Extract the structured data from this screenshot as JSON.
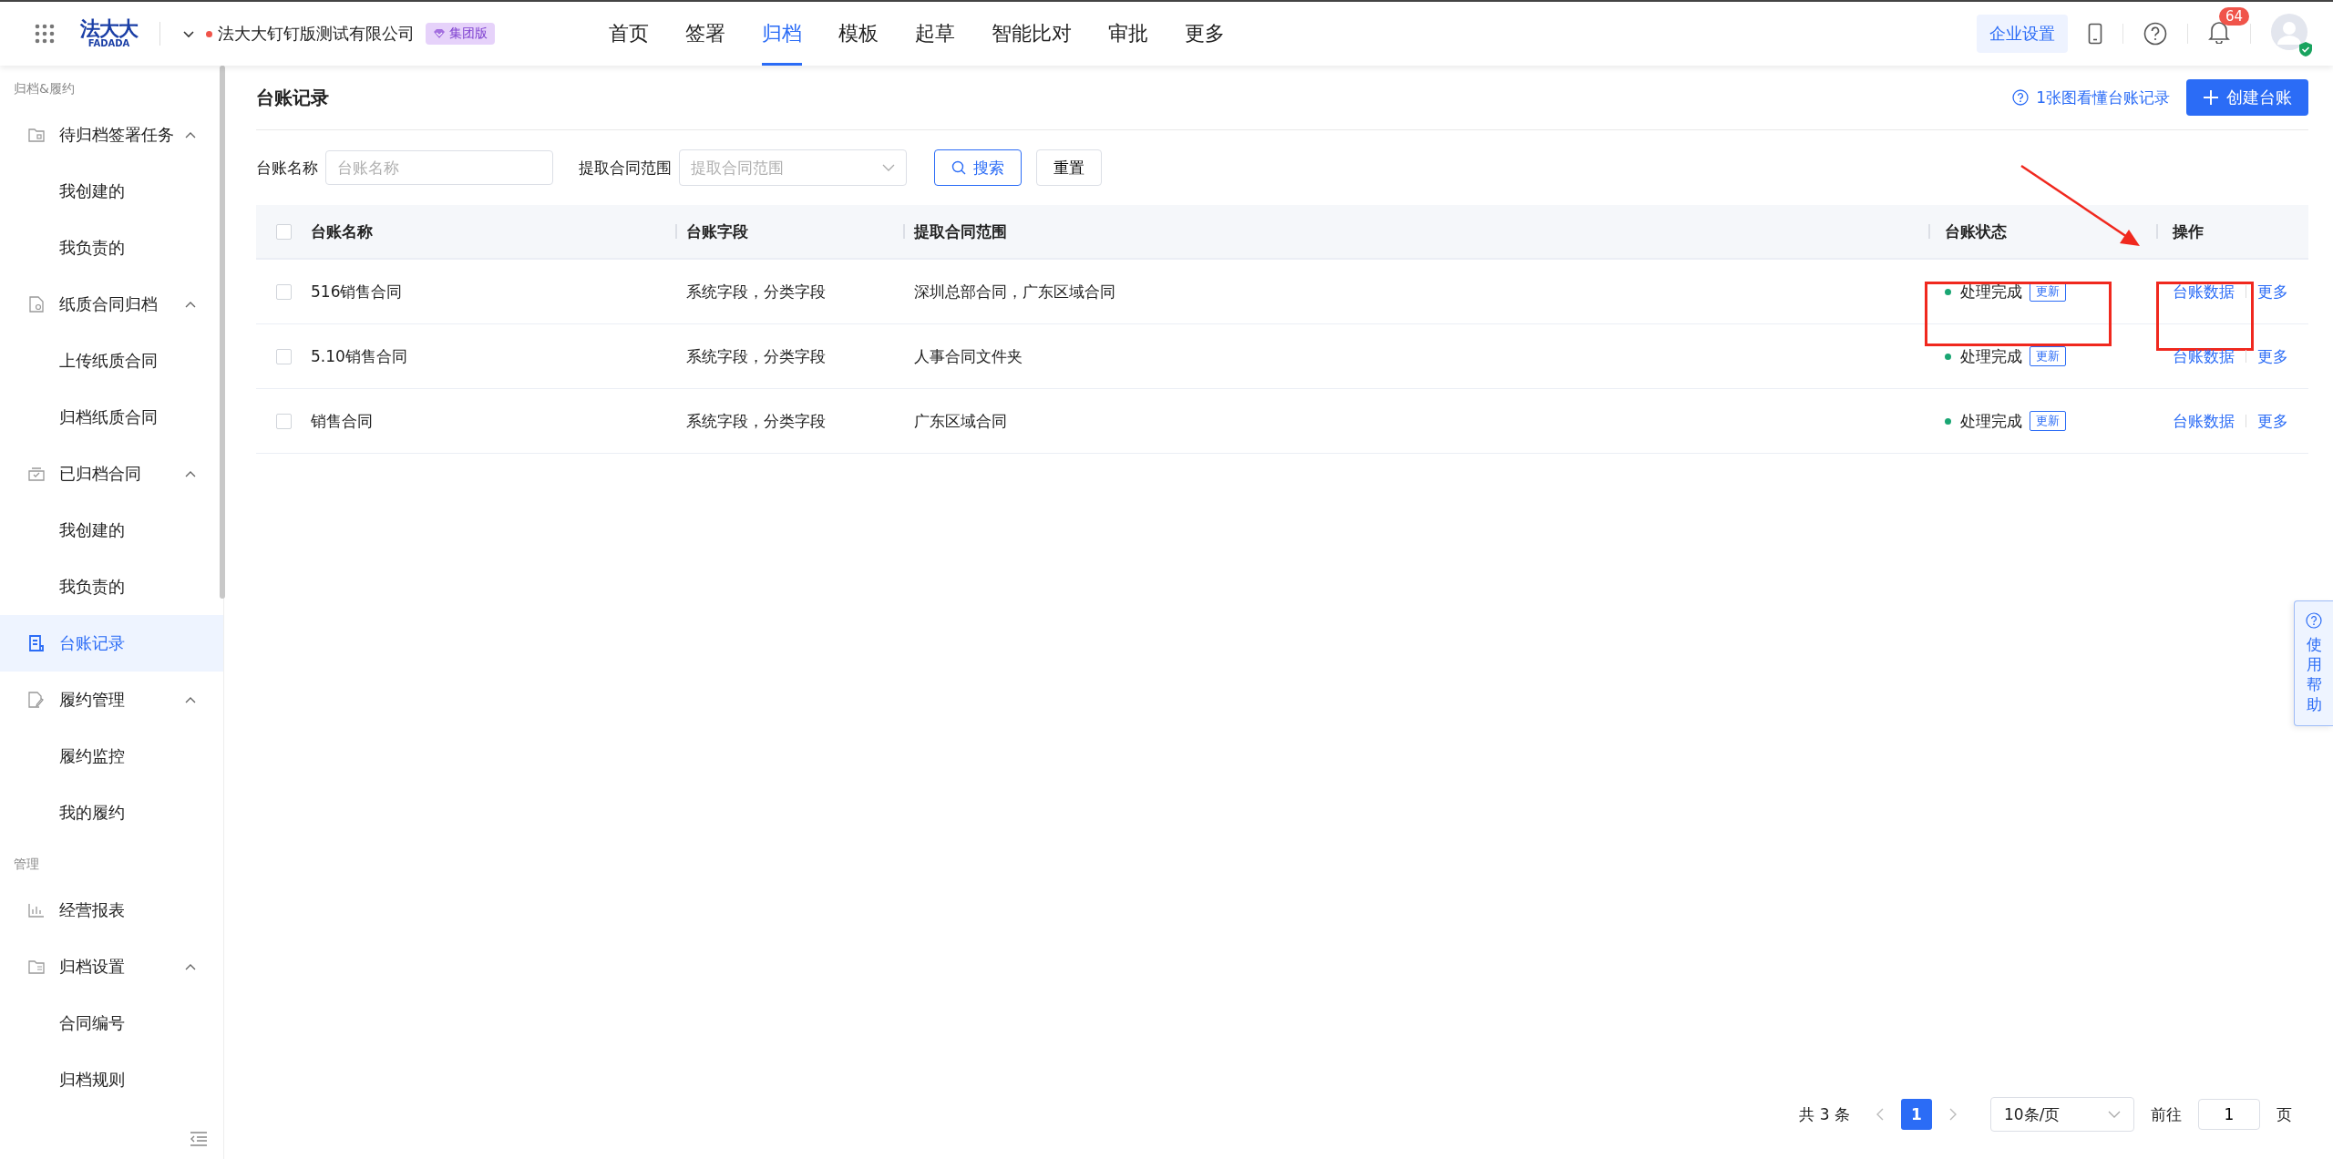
{
  "header": {
    "logo": {
      "mark": "法大大",
      "sub": "FADADA"
    },
    "org": {
      "name": "法大大钉钉版测试有限公司",
      "edition": "集团版"
    },
    "nav": [
      {
        "label": "首页",
        "selected": false
      },
      {
        "label": "签署",
        "selected": false
      },
      {
        "label": "归档",
        "selected": true
      },
      {
        "label": "模板",
        "selected": false
      },
      {
        "label": "起草",
        "selected": false
      },
      {
        "label": "智能比对",
        "selected": false
      },
      {
        "label": "审批",
        "selected": false
      },
      {
        "label": "更多",
        "selected": false
      }
    ],
    "settings_button": "企业设置",
    "notification_count": "64"
  },
  "sidebar": {
    "sections": [
      {
        "title": "归档&履约",
        "items": [
          {
            "kind": "group",
            "label": "待归档签署任务",
            "expanded": true,
            "children": [
              {
                "label": "我创建的",
                "selected": false
              },
              {
                "label": "我负责的",
                "selected": false
              }
            ]
          },
          {
            "kind": "group",
            "label": "纸质合同归档",
            "expanded": true,
            "children": [
              {
                "label": "上传纸质合同",
                "selected": false
              },
              {
                "label": "归档纸质合同",
                "selected": false
              }
            ]
          },
          {
            "kind": "group",
            "label": "已归档合同",
            "expanded": true,
            "children": [
              {
                "label": "我创建的",
                "selected": false
              },
              {
                "label": "我负责的",
                "selected": false
              }
            ]
          },
          {
            "kind": "link",
            "label": "台账记录",
            "selected": true
          },
          {
            "kind": "group",
            "label": "履约管理",
            "expanded": true,
            "children": [
              {
                "label": "履约监控",
                "selected": false
              },
              {
                "label": "我的履约",
                "selected": false
              }
            ]
          }
        ]
      },
      {
        "title": "管理",
        "items": [
          {
            "kind": "link",
            "label": "经营报表",
            "selected": false
          },
          {
            "kind": "group",
            "label": "归档设置",
            "expanded": true,
            "children": [
              {
                "label": "合同编号",
                "selected": false
              },
              {
                "label": "归档规则",
                "selected": false
              }
            ]
          }
        ]
      }
    ]
  },
  "page": {
    "title": "台账记录",
    "help_link": "1张图看懂台账记录",
    "create_button": "创建台账"
  },
  "filters": [
    {
      "kind": "input",
      "label": "台账名称",
      "placeholder": "台账名称"
    },
    {
      "kind": "select",
      "label": "提取合同范围",
      "placeholder": "提取合同范围"
    }
  ],
  "search_button": "搜索",
  "reset_button": "重置",
  "table": {
    "select_all_checked": false,
    "columns": [
      "台账名称",
      "台账字段",
      "提取合同范围",
      "台账状态",
      "操作"
    ],
    "rows": [
      {
        "checked": false,
        "name": "516销售合同",
        "fields": "系统字段，分类字段",
        "scope": "深圳总部合同，广东区域合同",
        "status": "处理完成",
        "tag": "更新",
        "actions": [
          "台账数据",
          "更多"
        ],
        "highlighted": true
      },
      {
        "checked": false,
        "name": "5.10销售合同",
        "fields": "系统字段，分类字段",
        "scope": "人事合同文件夹",
        "status": "处理完成",
        "tag": "更新",
        "actions": [
          "台账数据",
          "更多"
        ],
        "highlighted": false
      },
      {
        "checked": false,
        "name": "销售合同",
        "fields": "系统字段，分类字段",
        "scope": "广东区域合同",
        "status": "处理完成",
        "tag": "更新",
        "actions": [
          "台账数据",
          "更多"
        ],
        "highlighted": false
      }
    ]
  },
  "pagination": {
    "total": "共 3 条",
    "pages": [
      {
        "label": "1",
        "selected": true
      }
    ],
    "page_size": "10条/页",
    "goto_label": "前往",
    "goto_value": "1",
    "goto_suffix": "页"
  },
  "help_tab": "使用帮助"
}
